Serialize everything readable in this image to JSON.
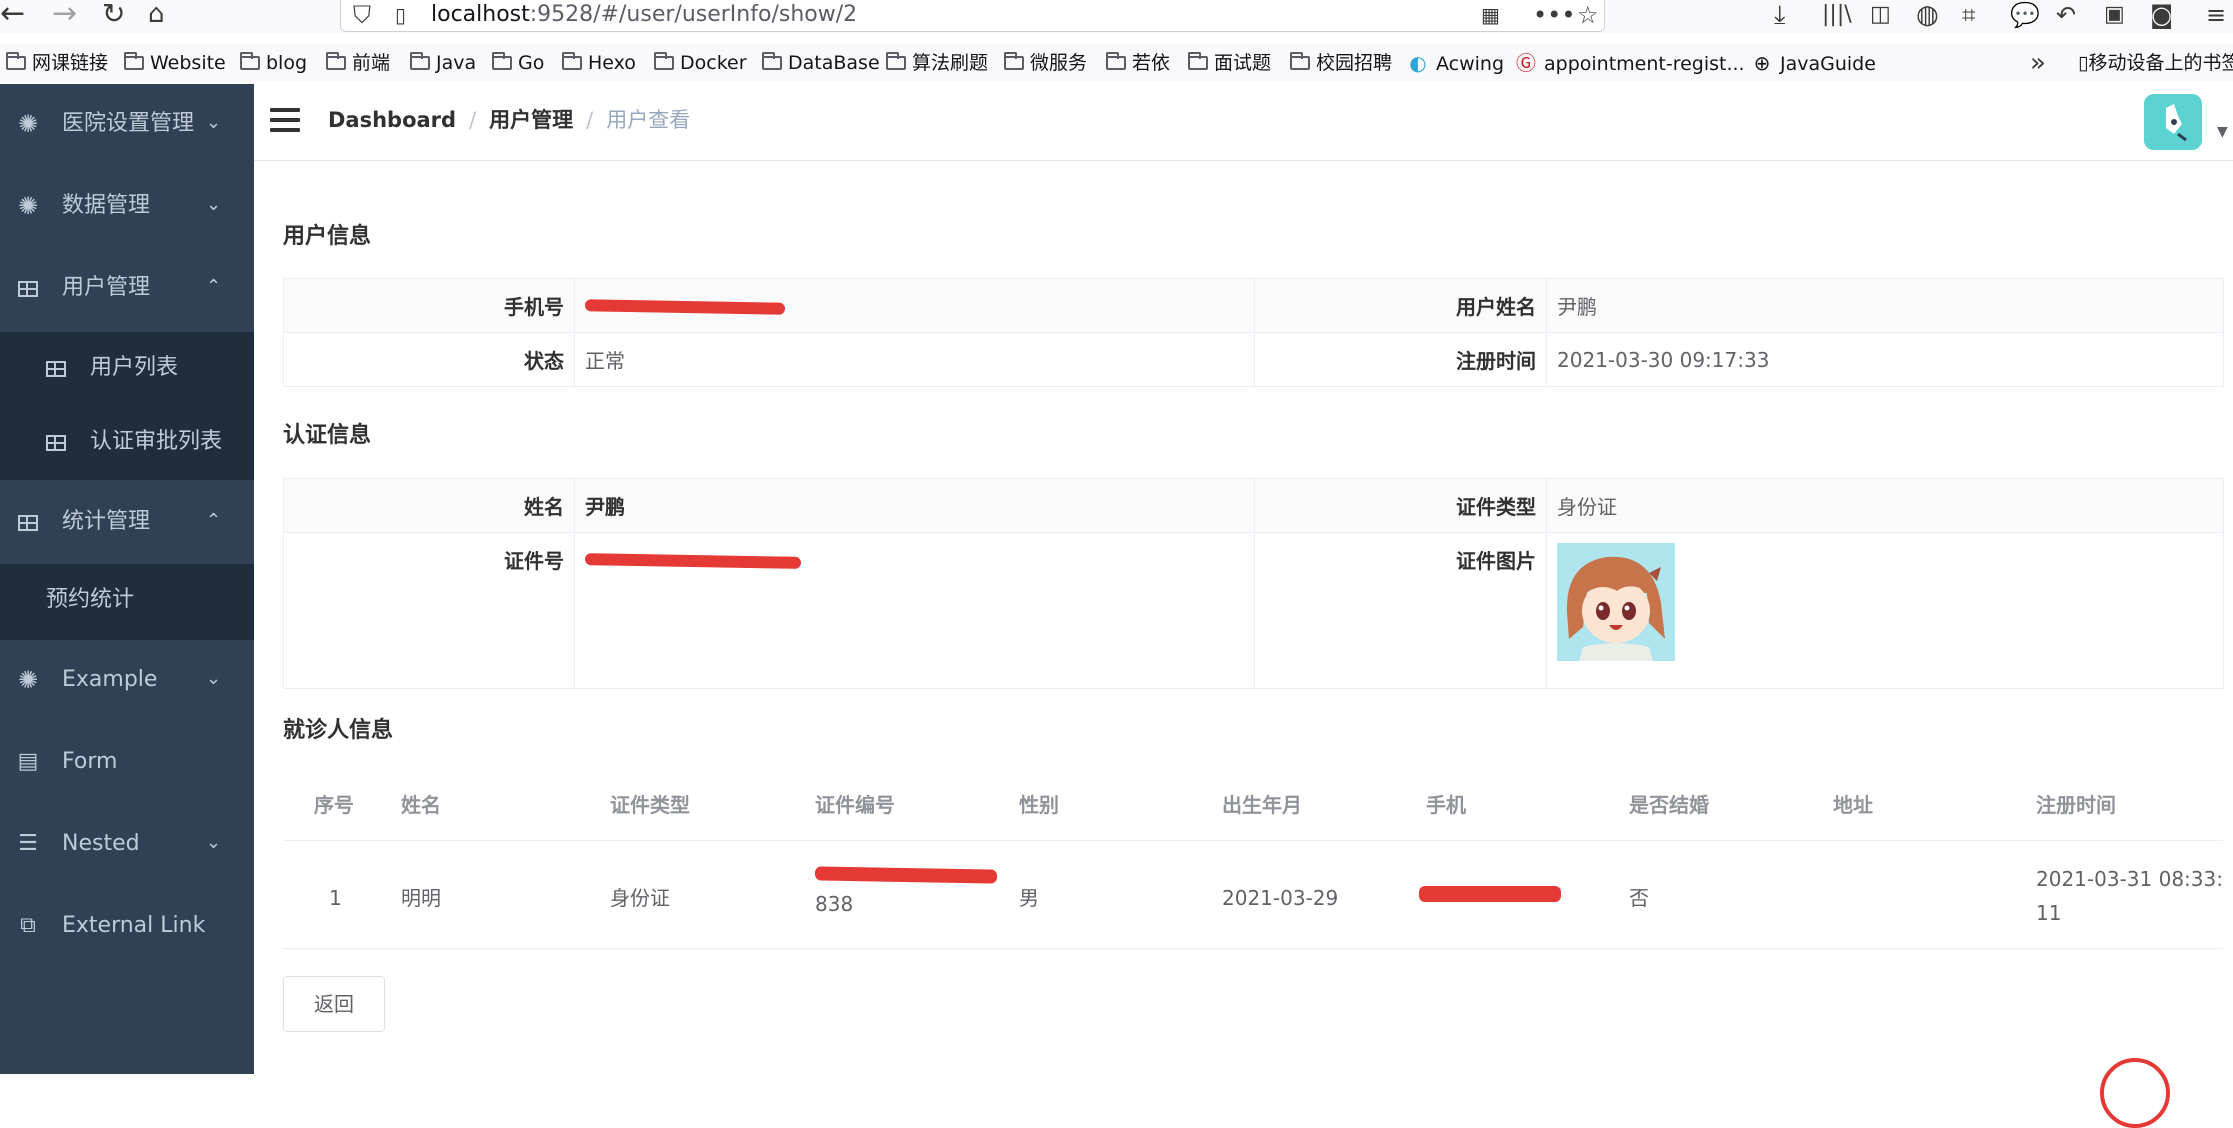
{
  "browser": {
    "url_host": "localhost",
    "url_path": ":9528/#/user/userInfo/show/2",
    "bookmarks": [
      {
        "label": "网课链接",
        "icon": "folder-icon"
      },
      {
        "label": "Website",
        "icon": "folder-icon"
      },
      {
        "label": "blog",
        "icon": "folder-icon"
      },
      {
        "label": "前端",
        "icon": "folder-icon"
      },
      {
        "label": "Java",
        "icon": "folder-icon"
      },
      {
        "label": "Go",
        "icon": "folder-icon"
      },
      {
        "label": "Hexo",
        "icon": "folder-icon"
      },
      {
        "label": "Docker",
        "icon": "folder-icon"
      },
      {
        "label": "DataBase",
        "icon": "folder-icon"
      },
      {
        "label": "算法刷题",
        "icon": "folder-icon"
      },
      {
        "label": "微服务",
        "icon": "folder-icon"
      },
      {
        "label": "若依",
        "icon": "folder-icon"
      },
      {
        "label": "面试题",
        "icon": "folder-icon"
      },
      {
        "label": "校园招聘",
        "icon": "folder-icon"
      },
      {
        "label": "Acwing",
        "icon": "acwing-icon"
      },
      {
        "label": "appointment-regist...",
        "icon": "gitee-icon"
      },
      {
        "label": "JavaGuide",
        "icon": "globe-icon"
      }
    ],
    "mobile_bookmarks": "移动设备上的书签"
  },
  "sidebar": {
    "items": [
      {
        "label": "医院设置管理",
        "icon": "gear-icon",
        "expanded": false
      },
      {
        "label": "数据管理",
        "icon": "gear-icon",
        "expanded": false
      },
      {
        "label": "用户管理",
        "icon": "table-icon",
        "expanded": true
      },
      {
        "label": "用户列表",
        "icon": "table-icon"
      },
      {
        "label": "认证审批列表",
        "icon": "table-icon"
      },
      {
        "label": "统计管理",
        "icon": "table-icon",
        "expanded": true
      },
      {
        "label": "预约统计"
      },
      {
        "label": "Example",
        "icon": "gear-icon",
        "expanded": false
      },
      {
        "label": "Form",
        "icon": "form-icon"
      },
      {
        "label": "Nested",
        "icon": "nested-icon",
        "expanded": false
      },
      {
        "label": "External Link",
        "icon": "external-link-icon"
      }
    ]
  },
  "breadcrumb": {
    "home": "Dashboard",
    "parent": "用户管理",
    "current": "用户查看"
  },
  "user_info": {
    "title": "用户信息",
    "phone_label": "手机号",
    "phone_value": "",
    "name_label": "用户姓名",
    "name_value": "尹鹏",
    "status_label": "状态",
    "status_value": "正常",
    "register_label": "注册时间",
    "register_value": "2021-03-30 09:17:33"
  },
  "auth_info": {
    "title": "认证信息",
    "name_label": "姓名",
    "name_value": "尹鹏",
    "cert_type_label": "证件类型",
    "cert_type_value": "身份证",
    "cert_no_label": "证件号",
    "cert_no_value": "",
    "cert_img_label": "证件图片"
  },
  "patients": {
    "title": "就诊人信息",
    "headers": [
      "序号",
      "姓名",
      "证件类型",
      "证件编号",
      "性别",
      "出生年月",
      "手机",
      "是否结婚",
      "地址",
      "注册时间"
    ],
    "rows": [
      {
        "index": "1",
        "name": "明明",
        "cert_type": "身份证",
        "cert_no_tail": "838",
        "gender": "男",
        "birth": "2021-03-29",
        "phone": "",
        "married": "否",
        "address": "",
        "register_line1": "2021-03-31 08:33:",
        "register_line2": "11"
      }
    ]
  },
  "actions": {
    "back_label": "返回"
  },
  "colors": {
    "sidebar_bg": "#304156",
    "submenu_bg": "#1f2d3d",
    "sidebar_text": "#bfcbd9",
    "redaction": "#e53935",
    "avatar_bg": "#5cd3d1"
  }
}
